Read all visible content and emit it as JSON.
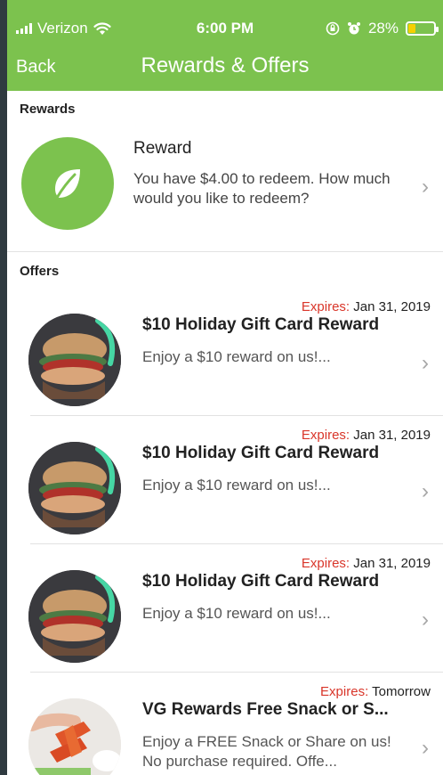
{
  "status": {
    "carrier": "Verizon",
    "time": "6:00 PM",
    "battery_percent": "28%",
    "battery_level": 0.28,
    "icons": [
      "signal-icon",
      "wifi-icon",
      "lock-rotation-icon",
      "alarm-icon",
      "battery-icon"
    ]
  },
  "nav": {
    "back_label": "Back",
    "title": "Rewards & Offers"
  },
  "rewards_section": {
    "label": "Rewards",
    "card": {
      "title": "Reward",
      "description": "You have $4.00 to redeem. How much would you like to redeem?",
      "icon": "leaf-icon"
    }
  },
  "offers_section": {
    "label": "Offers",
    "expires_label": "Expires:",
    "items": [
      {
        "expires": "Jan 31, 2019",
        "title": "$10 Holiday Gift Card Reward",
        "description": "Enjoy a $10 reward on us!..."
      },
      {
        "expires": "Jan 31, 2019",
        "title": "$10 Holiday Gift Card Reward",
        "description": "Enjoy a $10 reward on us!..."
      },
      {
        "expires": "Jan 31, 2019",
        "title": "$10 Holiday Gift Card Reward",
        "description": "Enjoy a $10 reward on us!..."
      },
      {
        "expires": "Tomorrow",
        "title": "VG Rewards Free Snack or S...",
        "description": "Enjoy a FREE Snack or Share on us! No purchase required. Offe..."
      }
    ]
  },
  "colors": {
    "brand_green": "#7cc24e",
    "expires_red": "#d9362a",
    "background": "#ffffff"
  }
}
